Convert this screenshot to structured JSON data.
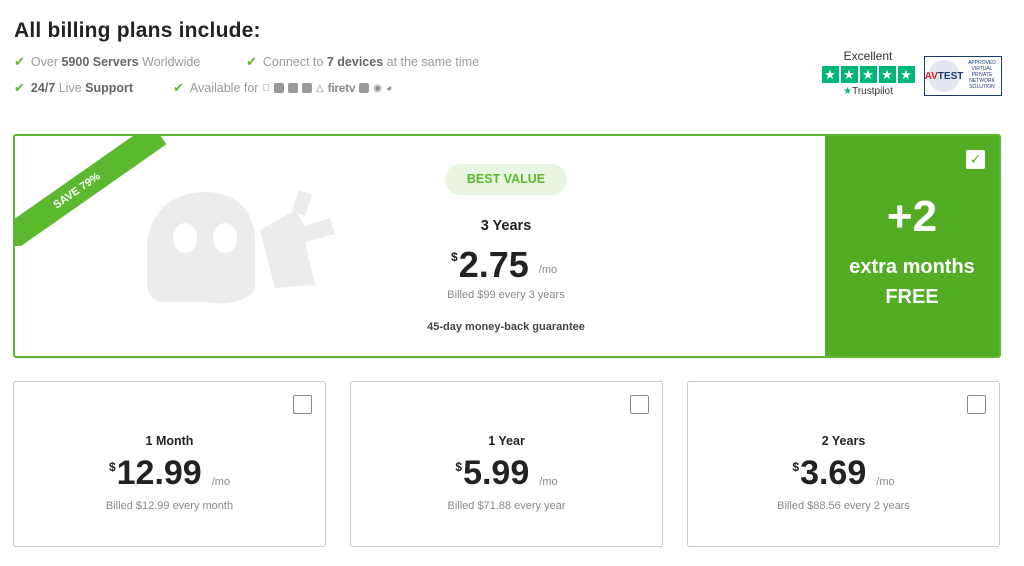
{
  "header": {
    "title": "All billing plans include:"
  },
  "features": {
    "servers": {
      "pre": "Over",
      "bold": "5900 Servers",
      "post": "Worldwide"
    },
    "devices": {
      "pre": "Connect to",
      "bold": "7 devices",
      "post": "at the same time"
    },
    "support": {
      "bold1": "24/7",
      "mid": "Live",
      "bold2": "Support"
    },
    "available": {
      "label": "Available for",
      "firetv": "firetv"
    }
  },
  "trustpilot": {
    "rating": "Excellent",
    "brand": "Trustpilot",
    "stars": 5,
    "color": "#00b67a"
  },
  "avtest": {
    "logo": "TEST",
    "prefix": "AV",
    "text": "APPROVED VIRTUAL PRIVATE NETWORK SOLUTION"
  },
  "featured_plan": {
    "ribbon": "SAVE 79%",
    "badge": "BEST VALUE",
    "term": "3 Years",
    "currency": "$",
    "price": "2.75",
    "per": "/mo",
    "billed": "Billed $99 every 3 years",
    "guarantee": "45-day money-back guarantee",
    "bonus_plus": "+2",
    "bonus_line1": "extra months",
    "bonus_line2": "FREE",
    "selected": true,
    "accent_color": "#5cb82e"
  },
  "plans": [
    {
      "term": "1 Month",
      "currency": "$",
      "price": "12.99",
      "per": "/mo",
      "billed": "Billed $12.99 every month",
      "selected": false
    },
    {
      "term": "1 Year",
      "currency": "$",
      "price": "5.99",
      "per": "/mo",
      "billed": "Billed $71.88 every year",
      "selected": false
    },
    {
      "term": "2 Years",
      "currency": "$",
      "price": "3.69",
      "per": "/mo",
      "billed": "Billed $88.56 every 2 years",
      "selected": false
    }
  ]
}
